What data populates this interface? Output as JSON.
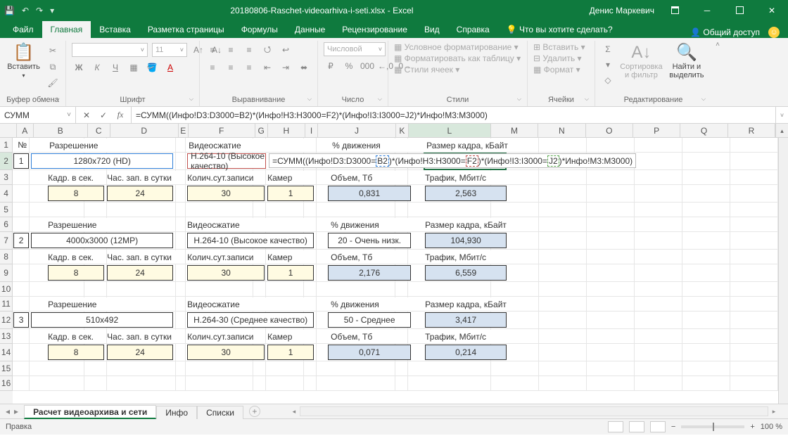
{
  "titlebar": {
    "filename": "20180806-Raschet-videoarhiva-i-seti.xlsx  -  Excel",
    "user": "Денис Маркевич"
  },
  "tabs": {
    "file": "Файл",
    "home": "Главная",
    "insert": "Вставка",
    "layout": "Разметка страницы",
    "formulas": "Формулы",
    "data": "Данные",
    "review": "Рецензирование",
    "view": "Вид",
    "help": "Справка",
    "tellme": "Что вы хотите сделать?",
    "share": "Общий доступ"
  },
  "ribbon": {
    "paste": "Вставить",
    "clipboard": "Буфер обмена",
    "font_group": "Шрифт",
    "align_group": "Выравнивание",
    "number_group": "Число",
    "styles_group": "Стили",
    "cells_group": "Ячейки",
    "editing_group": "Редактирование",
    "font_size": "11",
    "number_format": "Числовой",
    "cond_fmt": "Условное форматирование",
    "as_table": "Форматировать как таблицу",
    "cell_styles": "Стили ячеек",
    "insert": "Вставить",
    "delete": "Удалить",
    "format": "Формат",
    "sort": "Сортировка и фильтр",
    "find": "Найти и выделить",
    "bold": "Ж",
    "italic": "К",
    "underline": "Ч"
  },
  "formula_bar": {
    "name_box": "СУММ",
    "fx": "fx",
    "formula": "=СУММ((Инфо!D3:D3000=B2)*(Инфо!H3:H3000=F2)*(Инфо!I3:I3000=J2)*Инфо!M3:M3000)",
    "overlap": {
      "p1": "=СУММ((Инфо!D3:D3000=",
      "b": "B2",
      "p2": ")*(Инфо!H3:H3000=",
      "f": "F2",
      "p3": ")*(Инфо!I3:I3000=",
      "j": "J2",
      "p4": ")*Инфо!M3:M3000)"
    }
  },
  "cols": [
    "A",
    "B",
    "C",
    "D",
    "E",
    "F",
    "G",
    "H",
    "I",
    "J",
    "K",
    "L",
    "M",
    "N",
    "O",
    "P",
    "Q",
    "R"
  ],
  "rows": [
    "1",
    "2",
    "3",
    "4",
    "5",
    "6",
    "7",
    "8",
    "9",
    "10",
    "11",
    "12",
    "13",
    "14",
    "15",
    "16"
  ],
  "labels": {
    "no": "№",
    "resolution": "Разрешение",
    "codec": "Видеосжатие",
    "motion": "% движения",
    "frame_size": "Размер кадра, кБайт",
    "fps": "Кадр. в сек.",
    "hours": "Час. зап. в сутки",
    "days": "Колич.сут.записи",
    "cams": "Камер",
    "volume": "Объем, Тб",
    "traffic": "Трафик, Мбит/с"
  },
  "block1": {
    "no": "1",
    "resolution": "1280x720 (HD)",
    "codec": "H.264-10 (Высокое качество)",
    "motion": "",
    "frame_size": "",
    "fps": "8",
    "hours": "24",
    "days": "30",
    "cams": "1",
    "volume": "0,831",
    "traffic": "2,563"
  },
  "block2": {
    "no": "2",
    "resolution": "4000x3000 (12MP)",
    "codec": "H.264-10 (Высокое качество)",
    "motion": "20 - Очень низк.",
    "frame_size": "104,930",
    "fps": "8",
    "hours": "24",
    "days": "30",
    "cams": "1",
    "volume": "2,176",
    "traffic": "6,559"
  },
  "block3": {
    "no": "3",
    "resolution": "510x492",
    "codec": "H.264-30 (Среднее качество)",
    "motion": "50 - Среднее",
    "frame_size": "3,417",
    "fps": "8",
    "hours": "24",
    "days": "30",
    "cams": "1",
    "volume": "0,071",
    "traffic": "0,214"
  },
  "sheets": {
    "s1": "Расчет видеоархива и сети",
    "s2": "Инфо",
    "s3": "Списки"
  },
  "status": {
    "mode": "Правка",
    "zoom": "100 %"
  }
}
